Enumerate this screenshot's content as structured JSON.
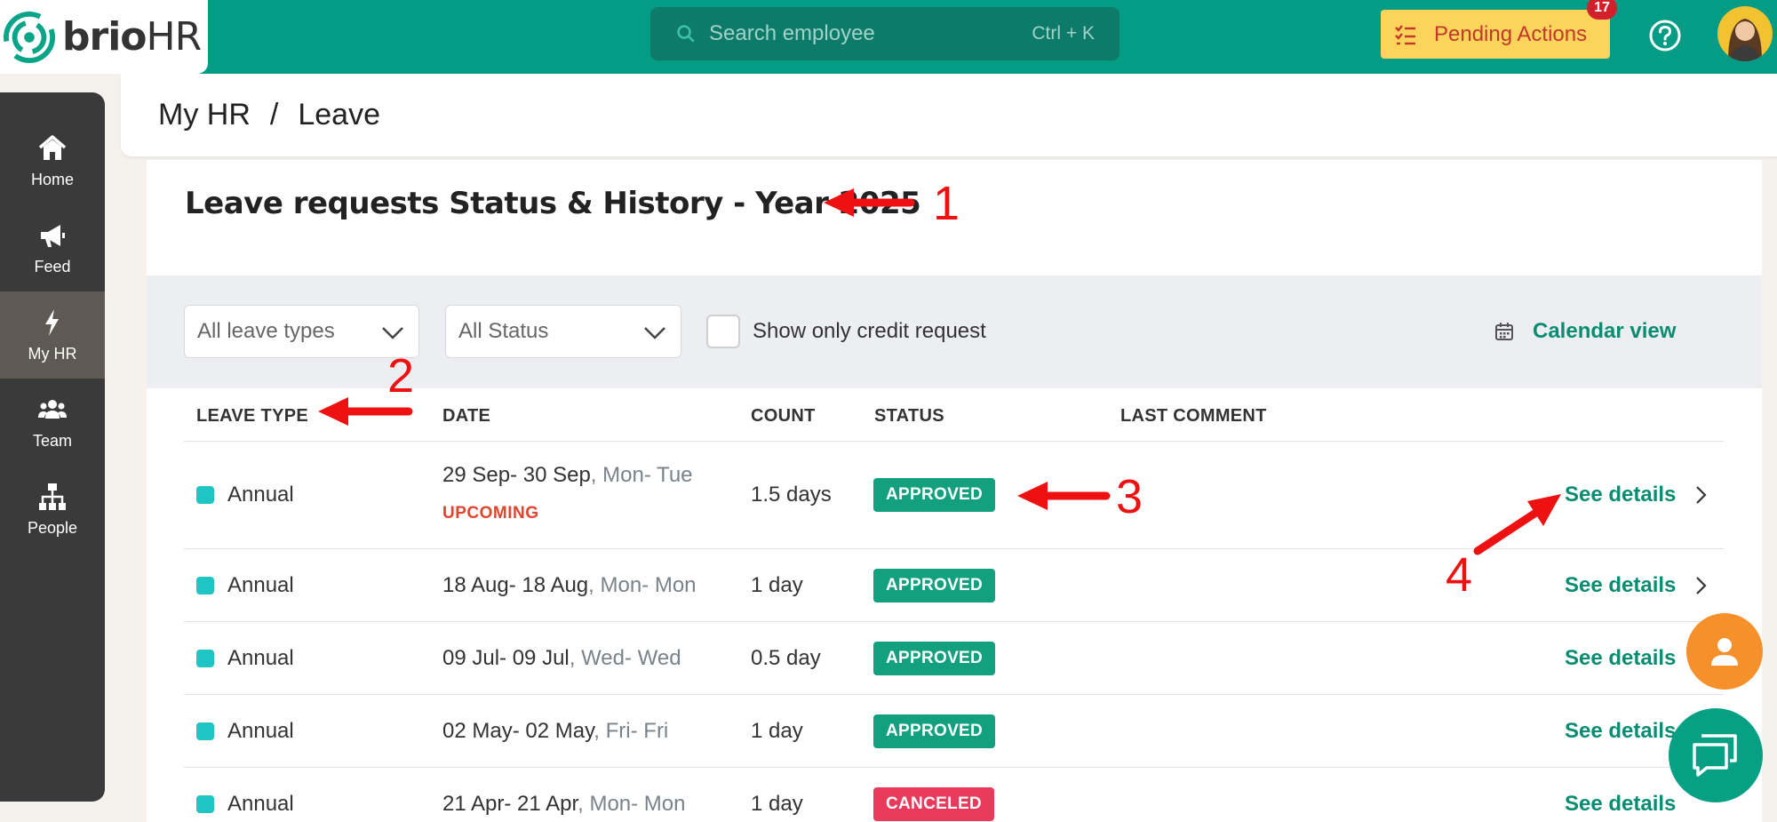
{
  "app": {
    "brand_main": "brio",
    "brand_suffix": "HR"
  },
  "topbar": {
    "search_placeholder": "Search employee",
    "search_shortcut": "Ctrl + K",
    "pending_label": "Pending Actions",
    "pending_count": "17"
  },
  "sidebar": {
    "items": [
      {
        "label": "Home",
        "icon": "home-icon"
      },
      {
        "label": "Feed",
        "icon": "megaphone-icon"
      },
      {
        "label": "My HR",
        "icon": "bolt-icon",
        "active": true
      },
      {
        "label": "Team",
        "icon": "team-icon"
      },
      {
        "label": "People",
        "icon": "org-chart-icon"
      }
    ]
  },
  "breadcrumb": {
    "root": "My HR",
    "separator": "/",
    "current": "Leave"
  },
  "page": {
    "title": "Leave requests Status & History - Year 2025"
  },
  "filters": {
    "leave_type": "All leave types",
    "status": "All Status",
    "credit_only_label": "Show only credit request",
    "calendar_view_label": "Calendar view"
  },
  "table": {
    "headers": {
      "leave_type": "LEAVE TYPE",
      "date": "DATE",
      "count": "COUNT",
      "status": "STATUS",
      "last_comment": "LAST COMMENT"
    },
    "rows": [
      {
        "type": "Annual",
        "date": "29 Sep- 30 Sep",
        "days": ", Mon- Tue",
        "tag": "UPCOMING",
        "count": "1.5 days",
        "status": "APPROVED",
        "details": "See details"
      },
      {
        "type": "Annual",
        "date": "18 Aug- 18 Aug",
        "days": ", Mon- Mon",
        "count": "1 day",
        "status": "APPROVED",
        "details": "See details"
      },
      {
        "type": "Annual",
        "date": "09 Jul- 09 Jul",
        "days": ", Wed- Wed",
        "count": "0.5 day",
        "status": "APPROVED",
        "details": "See details"
      },
      {
        "type": "Annual",
        "date": "02 May- 02 May",
        "days": ", Fri- Fri",
        "count": "1 day",
        "status": "APPROVED",
        "details": "See details"
      },
      {
        "type": "Annual",
        "date": "21 Apr- 21 Apr",
        "days": ", Mon- Mon",
        "count": "1 day",
        "status": "CANCELED",
        "details": "See details"
      }
    ]
  },
  "annotations": [
    "1",
    "2",
    "3",
    "4"
  ],
  "colors": {
    "brand_green": "#049c84",
    "pending_yellow": "#fcd35b",
    "approved": "#12a07f",
    "canceled": "#e83a5a",
    "annotation_red": "#ee1111"
  }
}
